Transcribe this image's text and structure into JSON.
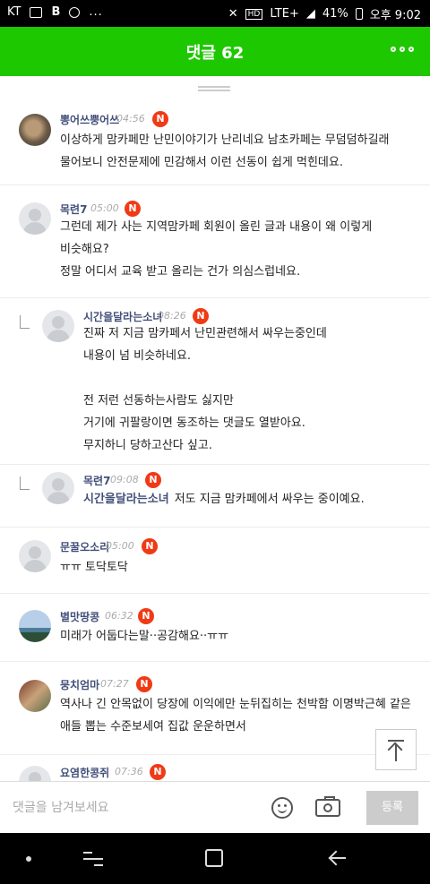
{
  "status": {
    "carrier": "KT",
    "network": "LTE+",
    "battery": "41%",
    "time": "오후 9:02",
    "dots": "..."
  },
  "header": {
    "title": "댓글 62"
  },
  "comments": [
    {
      "author": "뽕어쓰뿡어쓰",
      "time": "04:56",
      "badge": "N",
      "text": "이상하게 맘카페만 난민이야기가 난리네요 남초카페는 무덤덤하길래\n물어보니 안전문제에 민감해서 이런 선동이 쉽게 먹힌데요."
    },
    {
      "author": "목련7",
      "time": "05:00",
      "badge": "N",
      "text": "그런데 제가 사는 지역맘카페 회원이 올린 글과 내용이 왜 이렇게\n비슷해요?\n정말 어디서 교육 받고 올리는 건가 의심스럽네요."
    },
    {
      "author": "시간을달라는소녀",
      "time": "08:26",
      "badge": "N",
      "text": "진짜 저 지금 맘카페서 난민관련해서 싸우는중인데\n내용이 넘 비슷하네요.\n\n전 저런 선동하는사람도 싫지만\n거기에 귀팔랑이면 동조하는 댓글도 열받아요.\n무지하니 당하고산다 싶고."
    },
    {
      "author": "목련7",
      "time": "09:08",
      "badge": "N",
      "mention": "시간을달라는소녀",
      "text": "저도 지금 맘카페에서 싸우는 중이예요."
    },
    {
      "author": "문꿀오소리",
      "time": "05:00",
      "badge": "N",
      "text": "ㅠㅠ 토닥토닥"
    },
    {
      "author": "별맛땅콩",
      "time": "06:32",
      "badge": "N",
      "text": "미래가 어둡다는말··공감해요··ㅠㅠ"
    },
    {
      "author": "뭉치엄마",
      "time": "07:27",
      "badge": "N",
      "text": "역사나 긴 안목없이 당장에 이익에만 눈뒤집히는 천박함 이명박근혜 같은\n애들 뽑는 수준보세여 집값 운운하면서"
    },
    {
      "author": "요염한콩쥐",
      "time": "07:36",
      "badge": "N",
      "text": ""
    }
  ],
  "input": {
    "placeholder": "댓글을 남겨보세요",
    "submit_label": "등록"
  },
  "colors": {
    "header_green": "#1ec800",
    "badge_red": "#f03a16",
    "author_blue": "#43507a"
  },
  "icons": [
    "more-icon",
    "scroll-top-icon",
    "emoji-icon",
    "camera-icon",
    "reply-arrow-icon"
  ]
}
